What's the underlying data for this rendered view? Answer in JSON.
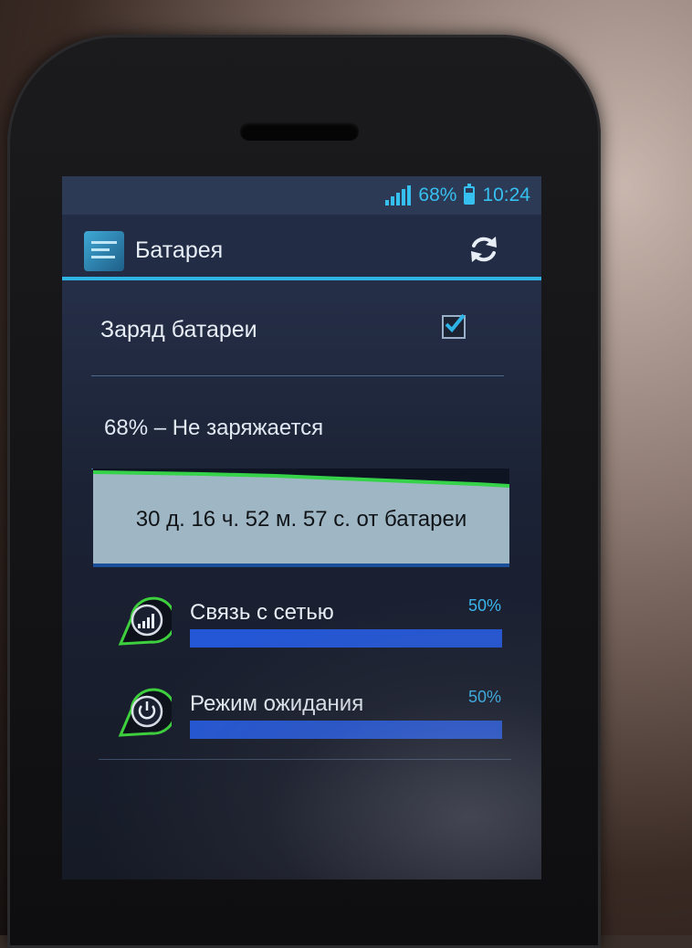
{
  "status_bar": {
    "battery_percent": "68%",
    "time": "10:24",
    "battery_level": 0.68,
    "accent_color": "#36c0f0"
  },
  "action_bar": {
    "title": "Батарея",
    "app_icon": "battery-settings-icon",
    "refresh_icon": "refresh-icon"
  },
  "battery_charge": {
    "label": "Заряд батареи",
    "checked": true
  },
  "battery_status": "68% – Не заряжается",
  "history": {
    "caption": "30 д. 16 ч. 52 м. 57 с. от батареи",
    "line_color": "#35d24a",
    "fill_color": "#9fb7c4"
  },
  "usage": [
    {
      "label": "Связь с сетью",
      "percent_text": "50%",
      "percent": 50,
      "icon": "cell-signal-icon"
    },
    {
      "label": "Режим ожидания",
      "percent_text": "50%",
      "percent": 50,
      "icon": "power-icon"
    }
  ]
}
